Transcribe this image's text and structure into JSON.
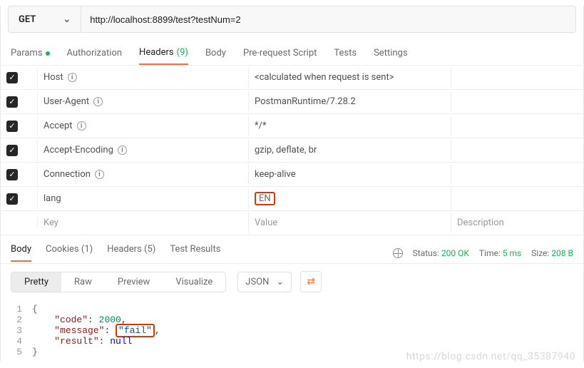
{
  "request": {
    "method": "GET",
    "url": "http://localhost:8899/test?testNum=2"
  },
  "tabs": {
    "params": "Params",
    "authorization": "Authorization",
    "headers": "Headers",
    "headers_count": "(9)",
    "body": "Body",
    "prerequest": "Pre-request Script",
    "tests": "Tests",
    "settings": "Settings"
  },
  "headers": [
    {
      "key": "Host",
      "value": "<calculated when request is sent>",
      "auto": true
    },
    {
      "key": "User-Agent",
      "value": "PostmanRuntime/7.28.2",
      "auto": true
    },
    {
      "key": "Accept",
      "value": "*/*",
      "auto": true
    },
    {
      "key": "Accept-Encoding",
      "value": "gzip, deflate, br",
      "auto": true
    },
    {
      "key": "Connection",
      "value": "keep-alive",
      "auto": true
    },
    {
      "key": "lang",
      "value": "EN",
      "auto": false
    }
  ],
  "placeholders": {
    "key": "Key",
    "value": "Value",
    "desc": "Description"
  },
  "response": {
    "tabs": {
      "body": "Body",
      "cookies": "Cookies",
      "cookies_count": "(1)",
      "headers": "Headers",
      "headers_count": "(5)",
      "tests": "Test Results"
    },
    "status_label": "Status:",
    "status_value": "200 OK",
    "time_label": "Time:",
    "time_value": "5 ms",
    "size_label": "Size:",
    "size_value": "208 B",
    "viewmodes": {
      "pretty": "Pretty",
      "raw": "Raw",
      "preview": "Preview",
      "visualize": "Visualize"
    },
    "lang": "JSON",
    "body": {
      "line2_key": "\"code\"",
      "line2_val": "2000",
      "line3_key": "\"message\"",
      "line3_val": "\"fail\"",
      "line4_key": "\"result\"",
      "line4_val": "null"
    }
  },
  "watermark": "https://blog.csdn.net/qq_35387940"
}
